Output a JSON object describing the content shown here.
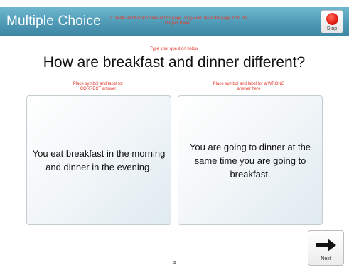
{
  "header": {
    "title": "Multiple Choice",
    "note": "To create additional copies of this page, copy and paste the page from the Project Panel",
    "stop_label": "Stop",
    "stop_icon": "stop-circle-icon",
    "stop_color": "#e11d12",
    "bar_color": "#4f9ab6"
  },
  "question": {
    "hint": "Type your question below",
    "text": "How are breakfast and dinner different?"
  },
  "answers": {
    "correct_hint": "Place symbol and label for CORRECT answer",
    "wrong_hint": "Place symbol and label for a WRONG answer here",
    "correct_text": "You eat breakfast in the morning and dinner in the evening.",
    "wrong_text": "You are going to dinner at the same time you are going to breakfast."
  },
  "footer": {
    "page_number": "#",
    "next_label": "Next",
    "next_icon": "right-arrow-icon"
  },
  "colors": {
    "hint_text": "#e33a2c"
  }
}
